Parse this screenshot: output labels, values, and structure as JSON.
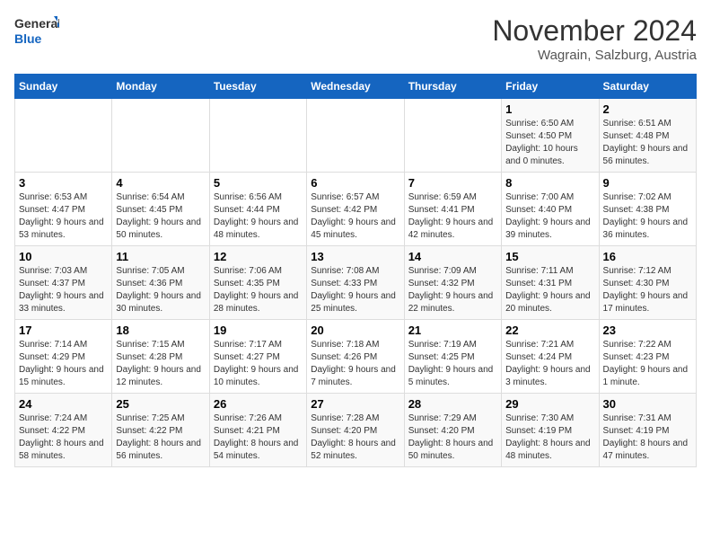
{
  "logo": {
    "line1": "General",
    "line2": "Blue"
  },
  "title": "November 2024",
  "subtitle": "Wagrain, Salzburg, Austria",
  "weekdays": [
    "Sunday",
    "Monday",
    "Tuesday",
    "Wednesday",
    "Thursday",
    "Friday",
    "Saturday"
  ],
  "weeks": [
    [
      {
        "day": "",
        "info": ""
      },
      {
        "day": "",
        "info": ""
      },
      {
        "day": "",
        "info": ""
      },
      {
        "day": "",
        "info": ""
      },
      {
        "day": "",
        "info": ""
      },
      {
        "day": "1",
        "info": "Sunrise: 6:50 AM\nSunset: 4:50 PM\nDaylight: 10 hours and 0 minutes."
      },
      {
        "day": "2",
        "info": "Sunrise: 6:51 AM\nSunset: 4:48 PM\nDaylight: 9 hours and 56 minutes."
      }
    ],
    [
      {
        "day": "3",
        "info": "Sunrise: 6:53 AM\nSunset: 4:47 PM\nDaylight: 9 hours and 53 minutes."
      },
      {
        "day": "4",
        "info": "Sunrise: 6:54 AM\nSunset: 4:45 PM\nDaylight: 9 hours and 50 minutes."
      },
      {
        "day": "5",
        "info": "Sunrise: 6:56 AM\nSunset: 4:44 PM\nDaylight: 9 hours and 48 minutes."
      },
      {
        "day": "6",
        "info": "Sunrise: 6:57 AM\nSunset: 4:42 PM\nDaylight: 9 hours and 45 minutes."
      },
      {
        "day": "7",
        "info": "Sunrise: 6:59 AM\nSunset: 4:41 PM\nDaylight: 9 hours and 42 minutes."
      },
      {
        "day": "8",
        "info": "Sunrise: 7:00 AM\nSunset: 4:40 PM\nDaylight: 9 hours and 39 minutes."
      },
      {
        "day": "9",
        "info": "Sunrise: 7:02 AM\nSunset: 4:38 PM\nDaylight: 9 hours and 36 minutes."
      }
    ],
    [
      {
        "day": "10",
        "info": "Sunrise: 7:03 AM\nSunset: 4:37 PM\nDaylight: 9 hours and 33 minutes."
      },
      {
        "day": "11",
        "info": "Sunrise: 7:05 AM\nSunset: 4:36 PM\nDaylight: 9 hours and 30 minutes."
      },
      {
        "day": "12",
        "info": "Sunrise: 7:06 AM\nSunset: 4:35 PM\nDaylight: 9 hours and 28 minutes."
      },
      {
        "day": "13",
        "info": "Sunrise: 7:08 AM\nSunset: 4:33 PM\nDaylight: 9 hours and 25 minutes."
      },
      {
        "day": "14",
        "info": "Sunrise: 7:09 AM\nSunset: 4:32 PM\nDaylight: 9 hours and 22 minutes."
      },
      {
        "day": "15",
        "info": "Sunrise: 7:11 AM\nSunset: 4:31 PM\nDaylight: 9 hours and 20 minutes."
      },
      {
        "day": "16",
        "info": "Sunrise: 7:12 AM\nSunset: 4:30 PM\nDaylight: 9 hours and 17 minutes."
      }
    ],
    [
      {
        "day": "17",
        "info": "Sunrise: 7:14 AM\nSunset: 4:29 PM\nDaylight: 9 hours and 15 minutes."
      },
      {
        "day": "18",
        "info": "Sunrise: 7:15 AM\nSunset: 4:28 PM\nDaylight: 9 hours and 12 minutes."
      },
      {
        "day": "19",
        "info": "Sunrise: 7:17 AM\nSunset: 4:27 PM\nDaylight: 9 hours and 10 minutes."
      },
      {
        "day": "20",
        "info": "Sunrise: 7:18 AM\nSunset: 4:26 PM\nDaylight: 9 hours and 7 minutes."
      },
      {
        "day": "21",
        "info": "Sunrise: 7:19 AM\nSunset: 4:25 PM\nDaylight: 9 hours and 5 minutes."
      },
      {
        "day": "22",
        "info": "Sunrise: 7:21 AM\nSunset: 4:24 PM\nDaylight: 9 hours and 3 minutes."
      },
      {
        "day": "23",
        "info": "Sunrise: 7:22 AM\nSunset: 4:23 PM\nDaylight: 9 hours and 1 minute."
      }
    ],
    [
      {
        "day": "24",
        "info": "Sunrise: 7:24 AM\nSunset: 4:22 PM\nDaylight: 8 hours and 58 minutes."
      },
      {
        "day": "25",
        "info": "Sunrise: 7:25 AM\nSunset: 4:22 PM\nDaylight: 8 hours and 56 minutes."
      },
      {
        "day": "26",
        "info": "Sunrise: 7:26 AM\nSunset: 4:21 PM\nDaylight: 8 hours and 54 minutes."
      },
      {
        "day": "27",
        "info": "Sunrise: 7:28 AM\nSunset: 4:20 PM\nDaylight: 8 hours and 52 minutes."
      },
      {
        "day": "28",
        "info": "Sunrise: 7:29 AM\nSunset: 4:20 PM\nDaylight: 8 hours and 50 minutes."
      },
      {
        "day": "29",
        "info": "Sunrise: 7:30 AM\nSunset: 4:19 PM\nDaylight: 8 hours and 48 minutes."
      },
      {
        "day": "30",
        "info": "Sunrise: 7:31 AM\nSunset: 4:19 PM\nDaylight: 8 hours and 47 minutes."
      }
    ]
  ]
}
